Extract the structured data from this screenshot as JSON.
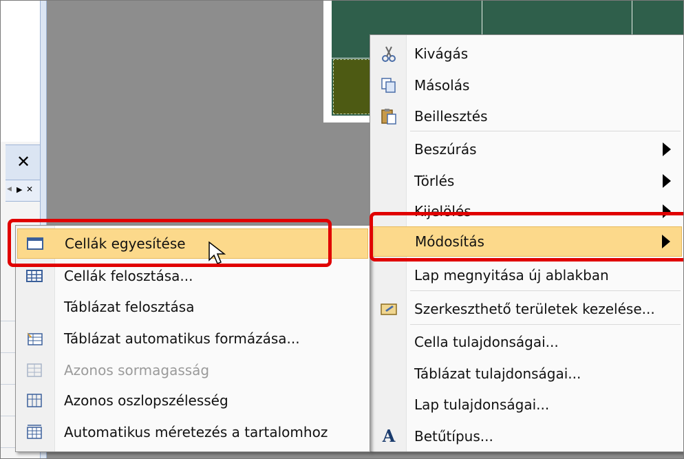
{
  "main_menu": {
    "items": [
      {
        "label": "Kivágás",
        "icon": "scissors-icon"
      },
      {
        "label": "Másolás",
        "icon": "copy-icon"
      },
      {
        "label": "Beillesztés",
        "icon": "paste-icon"
      },
      {
        "label": "Beszúrás",
        "submenu": true
      },
      {
        "label": "Törlés",
        "submenu": true
      },
      {
        "label": "Kijelölés",
        "submenu": true
      },
      {
        "label": "Módosítás",
        "submenu": true,
        "highlighted": true
      },
      {
        "label": "Lap megnyitása új ablakban"
      },
      {
        "label": "Szerkeszthető területek kezelése...",
        "icon": "editable-regions-icon"
      },
      {
        "label": "Cella tulajdonságai..."
      },
      {
        "label": "Táblázat tulajdonságai..."
      },
      {
        "label": "Lap tulajdonságai..."
      },
      {
        "label": "Betűtípus...",
        "icon": "font-icon"
      }
    ]
  },
  "sub_menu": {
    "items": [
      {
        "label": "Cellák egyesítése",
        "icon": "merge-cells-icon",
        "highlighted": true
      },
      {
        "label": "Cellák felosztása...",
        "icon": "split-cells-icon"
      },
      {
        "label": "Táblázat felosztása"
      },
      {
        "label": "Táblázat automatikus formázása...",
        "icon": "autoformat-table-icon"
      },
      {
        "label": "Azonos sormagasság",
        "icon": "distribute-rows-icon",
        "disabled": true
      },
      {
        "label": "Azonos oszlopszélesség",
        "icon": "distribute-columns-icon"
      },
      {
        "label": "Automatikus méretezés a tartalomhoz",
        "icon": "autofit-icon"
      }
    ]
  },
  "colors": {
    "highlight": "#fcd98b",
    "annotation_red": "#e00000",
    "table_green": "#2f5f4b",
    "cell_olive": "#4d5a13"
  },
  "panel": {
    "close_icon": "close-icon"
  }
}
